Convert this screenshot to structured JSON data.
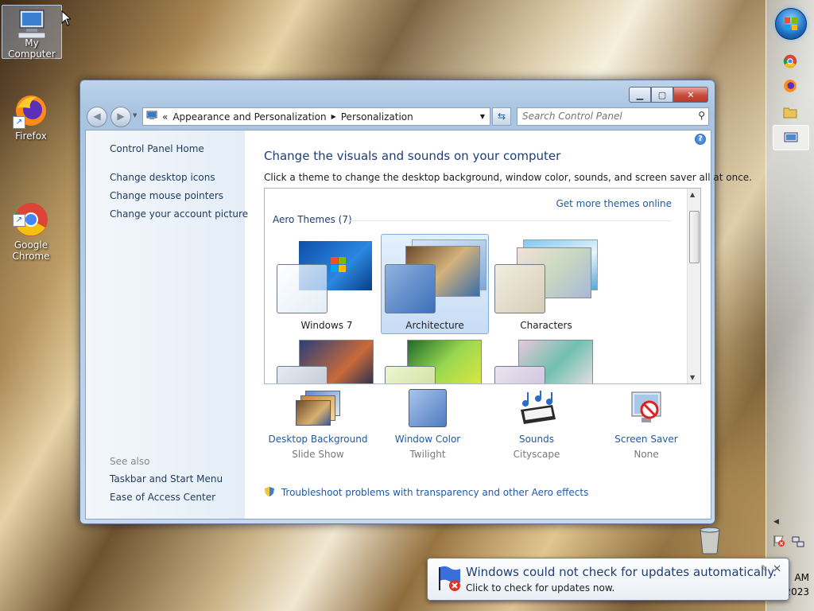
{
  "desktop": {
    "icons": [
      {
        "label": "My Computer"
      },
      {
        "label": "Firefox"
      },
      {
        "label": "Google\nChrome"
      }
    ]
  },
  "window": {
    "breadcrumb": [
      "Appearance and Personalization",
      "Personalization"
    ],
    "search_placeholder": "Search Control Panel",
    "left_pane": {
      "home": "Control Panel Home",
      "links": [
        "Change desktop icons",
        "Change mouse pointers",
        "Change your account picture"
      ],
      "see_also_label": "See also",
      "see_also": [
        "Taskbar and Start Menu",
        "Ease of Access Center"
      ]
    },
    "main": {
      "heading": "Change the visuals and sounds on your computer",
      "subtitle": "Click a theme to change the desktop background, window color, sounds, and screen saver all at once.",
      "more_themes": "Get more themes online",
      "group_label": "Aero Themes (7)",
      "themes": [
        {
          "name": "Windows 7"
        },
        {
          "name": "Architecture",
          "selected": true
        },
        {
          "name": "Characters"
        }
      ],
      "settings": [
        {
          "label": "Desktop Background",
          "value": "Slide Show"
        },
        {
          "label": "Window Color",
          "value": "Twilight"
        },
        {
          "label": "Sounds",
          "value": "Cityscape"
        },
        {
          "label": "Screen Saver",
          "value": "None"
        }
      ],
      "troubleshoot": "Troubleshoot problems with transparency and other Aero effects"
    }
  },
  "notification": {
    "title": "Windows could not check for updates automatically.",
    "text": "Click to check for updates now."
  },
  "clock": {
    "time": "AM",
    "year": "2023"
  },
  "colors": {
    "link": "#1e5aa8",
    "heading": "#1e3e78",
    "selection": "#c7ddf5"
  }
}
